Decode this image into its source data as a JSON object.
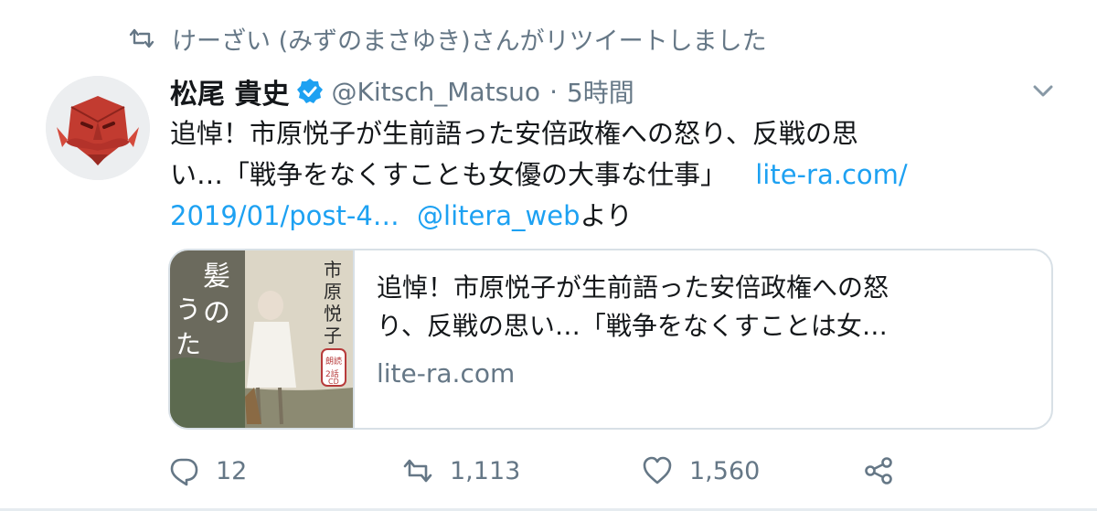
{
  "retweet_banner": {
    "text": "けーざい (みずのまさゆき)さんがリツイートしました",
    "icon": "retweet-icon"
  },
  "tweet": {
    "display_name": "松尾 貴史",
    "verified": true,
    "handle": "@Kitsch_Matsuo",
    "separator": "·",
    "time": "5時間",
    "text_line1": "追悼！市原悦子が生前語った安倍政権への怒り、反戦の思",
    "text_line2_prefix": "い…「戦争をなくすことも女優の大事な仕事」",
    "link_part1": "lite-ra.com/",
    "link_part2": "2019/01/post-4…",
    "mention": "@litera_web",
    "suffix": "より"
  },
  "card": {
    "title_line1": "追悼！市原悦子が生前語った安倍政権への怒",
    "title_line2": "り、反戦の思い…「戦争をなくすことは女…",
    "domain": "lite-ra.com",
    "image_text_author": "市原悦子",
    "image_text_title": "髪のうた",
    "image_badge": "朗読2話CD"
  },
  "actions": {
    "reply_count": "12",
    "retweet_count": "1,113",
    "like_count": "1,560"
  },
  "colors": {
    "link": "#1da1f2",
    "muted": "#657786",
    "text": "#14171a",
    "border": "#d8e0e6"
  }
}
